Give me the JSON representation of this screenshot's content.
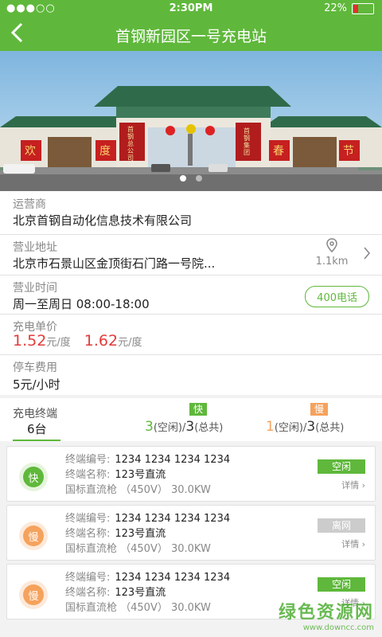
{
  "status_bar": {
    "signal": "●●●○○",
    "time": "2:30PM",
    "battery": "22%"
  },
  "nav": {
    "title": "首钢新园区一号充电站"
  },
  "banner": {
    "sign_left": "首钢总公司",
    "sign_right": "首钢集团",
    "chars": [
      "欢",
      "度",
      "春",
      "节"
    ]
  },
  "info": {
    "operator_label": "运营商",
    "operator_value": "北京首钢自动化信息技术有限公司",
    "address_label": "营业地址",
    "address_value": "北京市石景山区金顶街石门路一号院...",
    "distance": "1.1km",
    "hours_label": "营业时间",
    "hours_value": "周一至周日 08:00-18:00",
    "phone_button": "400电话",
    "price_label": "充电单价",
    "price1": "1.52",
    "price2": "1.62",
    "price_unit": "元/度",
    "parking_label": "停车费用",
    "parking_value": "5元/小时"
  },
  "terminal_summary": {
    "label": "充电终端",
    "total": "6台",
    "fast_badge": "快",
    "fast_free": "3",
    "fast_free_label": "(空闲)",
    "fast_sep": "/",
    "fast_total": "3",
    "fast_total_label": "(总共)",
    "slow_badge": "慢",
    "slow_free": "1",
    "slow_free_label": "(空闲)",
    "slow_sep": "/",
    "slow_total": "3",
    "slow_total_label": "(总共)"
  },
  "terminal_labels": {
    "no": "终端编号:",
    "name": "终端名称:",
    "detail": "详情"
  },
  "terminals": [
    {
      "type": "快",
      "no": "1234 1234 1234 1234",
      "name": "123号直流",
      "spec": "国标直流枪 （450V） 30.0KW",
      "status": "空闲"
    },
    {
      "type": "慢",
      "no": "1234 1234 1234 1234",
      "name": "123号直流",
      "spec": "国标直流枪 （450V） 30.0KW",
      "status": "离网"
    },
    {
      "type": "慢",
      "no": "1234 1234 1234 1234",
      "name": "123号直流",
      "spec": "国标直流枪 （450V） 30.0KW",
      "status": "空闲"
    }
  ],
  "watermark": {
    "line1": "绿色资源网",
    "line2": "www.downcc.com"
  },
  "colors": {
    "brand": "#5fb83b",
    "fast": "#5fb83b",
    "slow": "#f5a25d",
    "price": "#e23b3b",
    "offline": "#cccccc"
  }
}
